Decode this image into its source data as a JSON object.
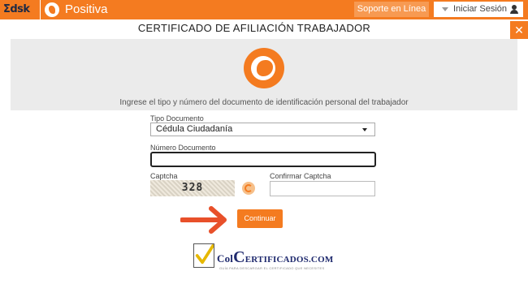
{
  "header": {
    "brand_mark": "Σdsk",
    "brand_name": "Positiva",
    "support_label": "Soporte en Línea",
    "login_label": "Iniciar Sesión"
  },
  "page": {
    "close_glyph": "✕",
    "title": "CERTIFICADO DE AFILIACIÓN TRABAJADOR",
    "instructions": "Ingrese el tipo y número del documento de identificación personal del trabajador"
  },
  "form": {
    "doc_type_label": "Tipo Documento",
    "doc_type_value": "Cédula Ciudadanía",
    "doc_number_label": "Número Documento",
    "doc_number_value": "",
    "captcha_label": "Captcha",
    "captcha_code": "328",
    "confirm_captcha_label": "Confirmar Captcha",
    "confirm_captcha_value": "",
    "continue_label": "Continuar"
  },
  "watermark": {
    "text_prefix": "Col",
    "text_big": "C",
    "text_suffix": "ertificados.com",
    "tagline": "GUÍA PARA DESCARGAR EL CERTIFICADO QUE NECESITES"
  },
  "colors": {
    "accent": "#f47b20",
    "arrow": "#e8502a",
    "check": "#e6b800"
  },
  "icons": [
    "user-icon",
    "caret-down-icon",
    "close-icon",
    "positiva-logo-icon",
    "refresh-icon",
    "arrow-right-icon",
    "checkmark-icon"
  ]
}
